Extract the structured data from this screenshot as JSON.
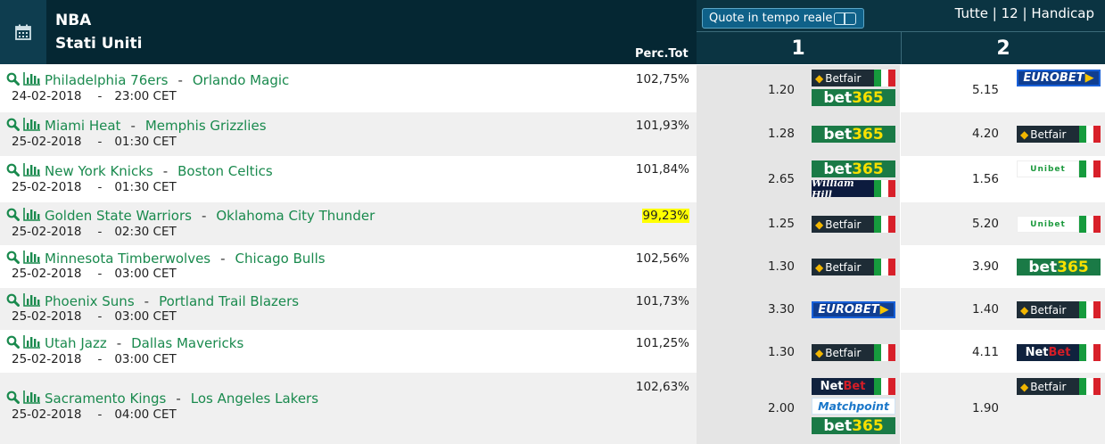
{
  "header": {
    "league": "NBA",
    "country": "Stati Uniti",
    "perc_label": "Perc.Tot",
    "live_button": "Quote in tempo reale",
    "filters": [
      "Tutte",
      "12",
      "Handicap"
    ],
    "filter_sep": "|",
    "col1": "1",
    "col2": "2"
  },
  "colors": {
    "header_bg": "#052733",
    "team_link": "#1a8a4e",
    "highlight": "#ffff00"
  },
  "rows": [
    {
      "home": "Philadelphia 76ers",
      "away": "Orlando Magic",
      "date": "24-02-2018",
      "time": "23:00 CET",
      "perc": "102,75%",
      "odd1": "1.20",
      "book1": [
        "Betfair",
        "bet365"
      ],
      "odd2": "5.15",
      "book2": [
        "EUROBET"
      ]
    },
    {
      "home": "Miami Heat",
      "away": "Memphis Grizzlies",
      "date": "25-02-2018",
      "time": "01:30 CET",
      "perc": "101,93%",
      "odd1": "1.28",
      "book1": [
        "bet365"
      ],
      "odd2": "4.20",
      "book2": [
        "Betfair"
      ]
    },
    {
      "home": "New York Knicks",
      "away": "Boston Celtics",
      "date": "25-02-2018",
      "time": "01:30 CET",
      "perc": "101,84%",
      "odd1": "2.65",
      "book1": [
        "bet365",
        "William Hill"
      ],
      "odd2": "1.56",
      "book2": [
        "Unibet"
      ]
    },
    {
      "home": "Golden State Warriors",
      "away": "Oklahoma City Thunder",
      "date": "25-02-2018",
      "time": "02:30 CET",
      "perc": "99,23%",
      "highlight": true,
      "odd1": "1.25",
      "book1": [
        "Betfair"
      ],
      "odd2": "5.20",
      "book2": [
        "Unibet"
      ]
    },
    {
      "home": "Minnesota Timberwolves",
      "away": "Chicago Bulls",
      "date": "25-02-2018",
      "time": "03:00 CET",
      "perc": "102,56%",
      "odd1": "1.30",
      "book1": [
        "Betfair"
      ],
      "odd2": "3.90",
      "book2": [
        "bet365"
      ]
    },
    {
      "home": "Phoenix Suns",
      "away": "Portland Trail Blazers",
      "date": "25-02-2018",
      "time": "03:00 CET",
      "perc": "101,73%",
      "odd1": "3.30",
      "book1": [
        "EUROBET"
      ],
      "odd2": "1.40",
      "book2": [
        "Betfair"
      ]
    },
    {
      "home": "Utah Jazz",
      "away": "Dallas Mavericks",
      "date": "25-02-2018",
      "time": "03:00 CET",
      "perc": "101,25%",
      "odd1": "1.30",
      "book1": [
        "Betfair"
      ],
      "odd2": "4.11",
      "book2": [
        "NetBet"
      ]
    },
    {
      "home": "Sacramento Kings",
      "away": "Los Angeles Lakers",
      "date": "25-02-2018",
      "time": "04:00 CET",
      "perc": "102,63%",
      "odd1": "2.00",
      "book1": [
        "NetBet",
        "Matchpoint",
        "bet365"
      ],
      "odd2": "1.90",
      "book2": [
        "Betfair"
      ]
    }
  ]
}
